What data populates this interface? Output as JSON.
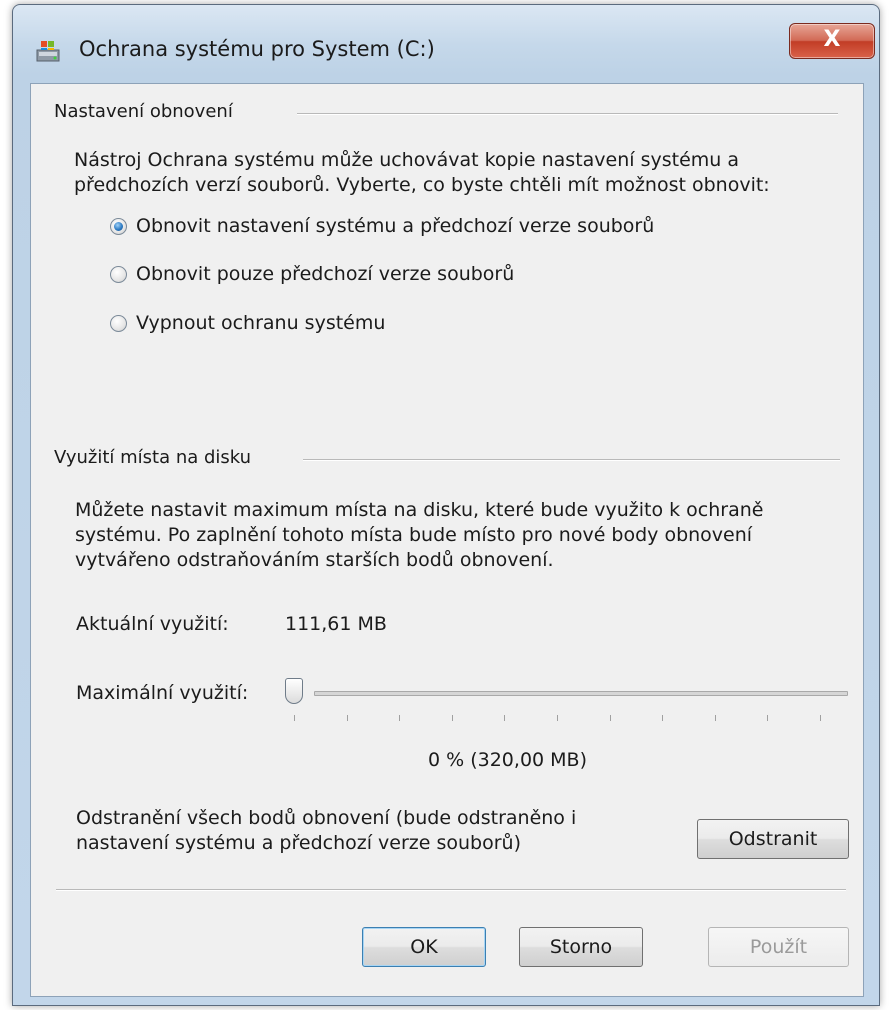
{
  "window": {
    "title": "Ochrana systému pro System (C:)",
    "close_label": "X"
  },
  "restore_settings": {
    "group_title": "Nastavení obnovení",
    "description": "Nástroj Ochrana systému může uchovávat kopie nastavení systému a předchozích verzí souborů. Vyberte, co byste chtěli mít možnost obnovit:",
    "options": [
      {
        "label": "Obnovit nastavení systému a předchozí verze souborů",
        "checked": true
      },
      {
        "label": "Obnovit pouze předchozí verze souborů",
        "checked": false
      },
      {
        "label": "Vypnout ochranu systému",
        "checked": false
      }
    ]
  },
  "disk_usage": {
    "group_title": "Využití místa na disku",
    "description": "Můžete nastavit maximum místa na disku, které bude využito k ochraně systému. Po zaplnění tohoto místa bude místo pro nové body obnovení vytvářeno odstraňováním starších bodů obnovení.",
    "current_label": "Aktuální využití:",
    "current_value": "111,61 MB",
    "max_label": "Maximální využití:",
    "slider_level_percent": 0,
    "slider_value_text": "0 % (320,00 MB)",
    "delete_text": "Odstranění všech bodů obnovení (bude odstraněno i nastavení systému a předchozí verze souborů)",
    "delete_button": "Odstranit"
  },
  "footer": {
    "ok": "OK",
    "cancel": "Storno",
    "apply": "Použít"
  },
  "colors": {
    "frame": "#c2d6ea",
    "client": "#f0f0f0",
    "close": "#c8452f",
    "radio_checked": "#2f7cc4"
  }
}
